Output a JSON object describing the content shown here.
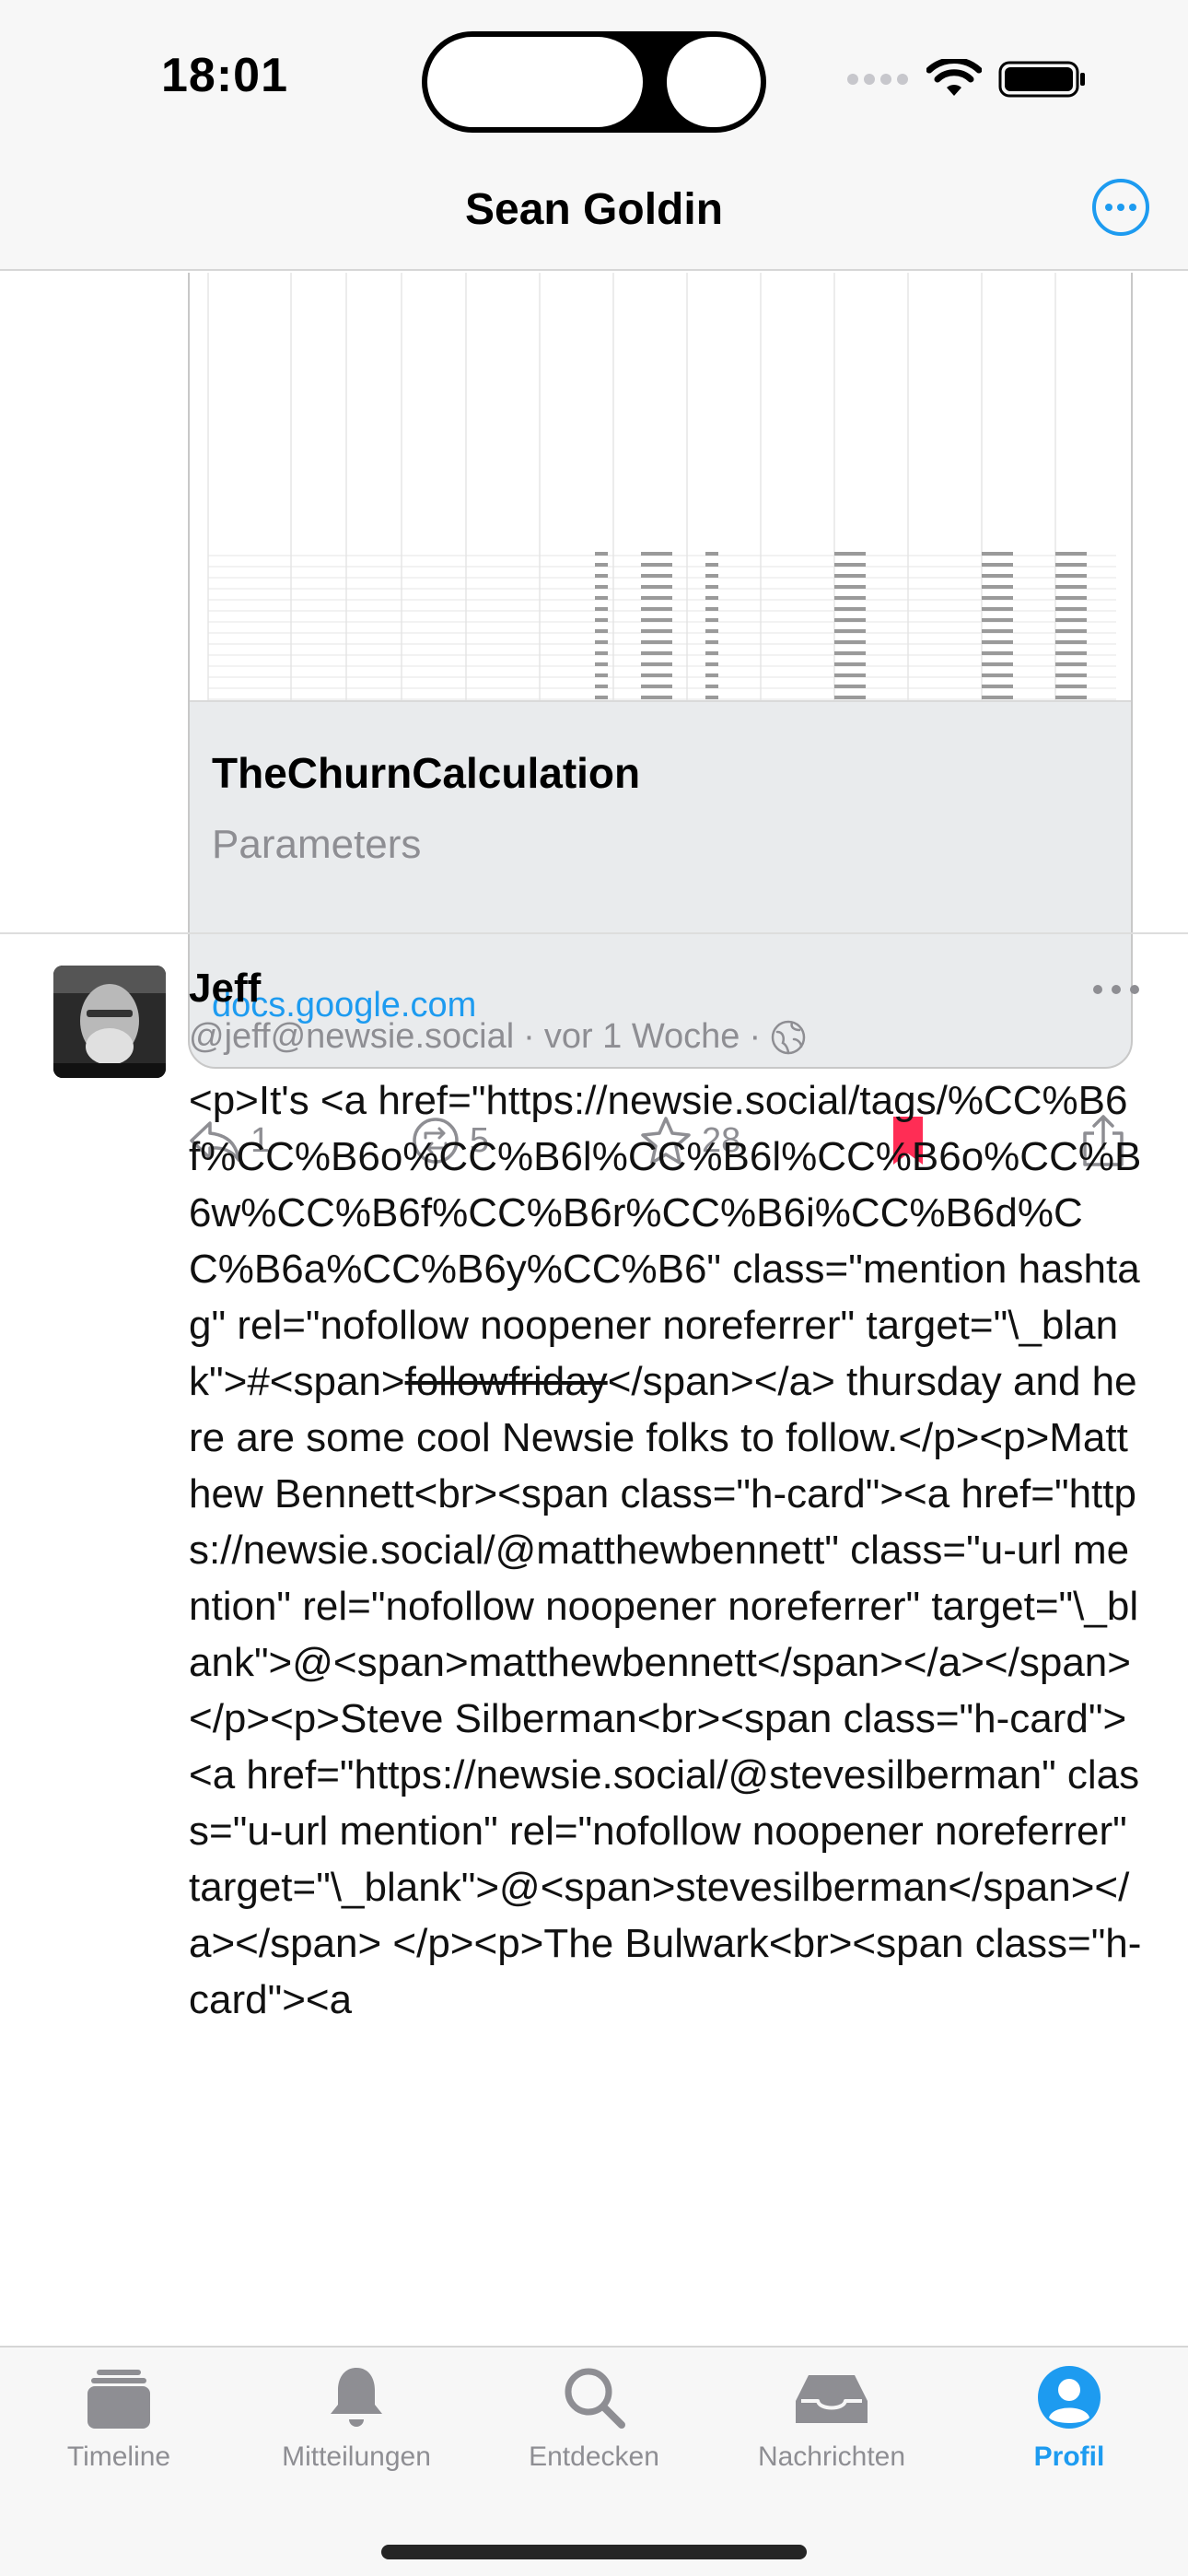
{
  "status_bar": {
    "time": "18:01"
  },
  "nav": {
    "title": "Sean Goldin",
    "more_icon": "ellipsis-circle-icon"
  },
  "link_card": {
    "title": "TheChurnCalculation",
    "subtitle": "Parameters",
    "domain": "docs.google.com"
  },
  "actions": {
    "reply_count": "1",
    "boost_count": "5",
    "favorite_count": "28",
    "bookmark_color": "#ff2d55"
  },
  "post": {
    "author": "Jeff",
    "handle": "@jeff@newsie.social",
    "separator": "·",
    "time": "vor 1 Woche",
    "body_before": "<p>It's ​<a href=\"https://newsie.social/tags/%CC%B6f%CC%B6o%CC%B6l%CC%B6l%CC%B6o%CC%B6w%CC%B6f%CC%B6r%CC%B6i%CC%B6d%CC%B6a%CC%B6y%CC%B6\" class=\"mention hashtag\" rel=\"nofollow noopener noreferrer\" target=\"\\_blank\">#<span>",
    "body_strike": "followfriday",
    "body_after": "</span></a> thursday and here are some cool Newsie folks to follow.</p><p>Matthew Bennett<br><span class=\"h-card\"><a href=\"https://newsie.social/@matthewbennett\" class=\"u-url mention\" rel=\"nofollow noopener noreferrer\" target=\"\\_blank\">@<span>matthewbennett</span></a></span> </p><p>Steve Silberman<br><span class=\"h-card\"><a href=\"https://newsie.social/@stevesilberman\" class=\"u-url mention\" rel=\"nofollow noopener noreferrer\" target=\"\\_blank\">@<span>stevesilberman</span></a></span> </p><p>The Bulwark<br><span class=\"h-card\"><a"
  },
  "tabs": [
    {
      "label": "Timeline",
      "icon": "stack-icon"
    },
    {
      "label": "Mitteilungen",
      "icon": "bell-icon"
    },
    {
      "label": "Entdecken",
      "icon": "search-icon"
    },
    {
      "label": "Nachrichten",
      "icon": "tray-icon"
    },
    {
      "label": "Profil",
      "icon": "person-circle-icon",
      "active": true
    }
  ],
  "colors": {
    "accent": "#1d9bf0",
    "muted": "#8e8e93"
  }
}
